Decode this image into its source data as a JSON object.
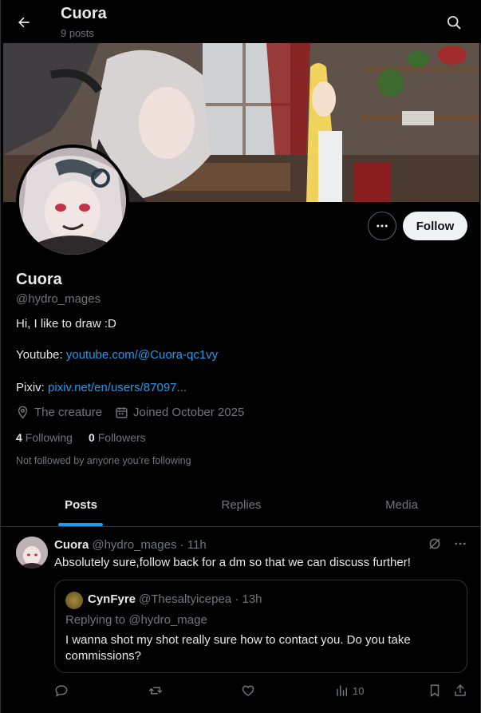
{
  "header": {
    "title": "Cuora",
    "post_count": "9 posts"
  },
  "profile": {
    "name": "Cuora",
    "handle": "@hydro_mages",
    "bio": "Hi, I like to draw :D",
    "youtube_label": "Youtube:",
    "youtube_link": "youtube.com/@Cuora-qc1vy",
    "pixiv_label": "Pixiv:",
    "pixiv_link": "pixiv.net/en/users/87097...",
    "location": "The creature",
    "joined": "Joined October 2025",
    "following_count": "4",
    "following_label": "Following",
    "followers_count": "0",
    "followers_label": "Followers",
    "not_followed": "Not followed by anyone you’re following",
    "follow_label": "Follow"
  },
  "tabs": [
    {
      "label": "Posts",
      "active": true
    },
    {
      "label": "Replies",
      "active": false
    },
    {
      "label": "Media",
      "active": false
    }
  ],
  "post": {
    "name": "Cuora",
    "handle_time": "@hydro_mages · 11h",
    "text": "Absolutely sure,follow back for a dm so that we can discuss further!",
    "quote": {
      "name": "CynFyre",
      "handle_time": "@Thesaltyicepea · 13h",
      "replying": "Replying to @hydro_mage",
      "text": "I wanna shot my shot really sure how to contact you. Do you take commissions?"
    },
    "views": "10"
  },
  "colors": {
    "accent": "#1d9bf0",
    "muted": "#71767b",
    "border": "#2f3336"
  },
  "icons": [
    "back-arrow-icon",
    "search-icon",
    "more-icon",
    "location-icon",
    "calendar-icon",
    "grok-icon",
    "reply-icon",
    "repost-icon",
    "like-icon",
    "views-icon",
    "bookmark-icon",
    "share-icon"
  ]
}
